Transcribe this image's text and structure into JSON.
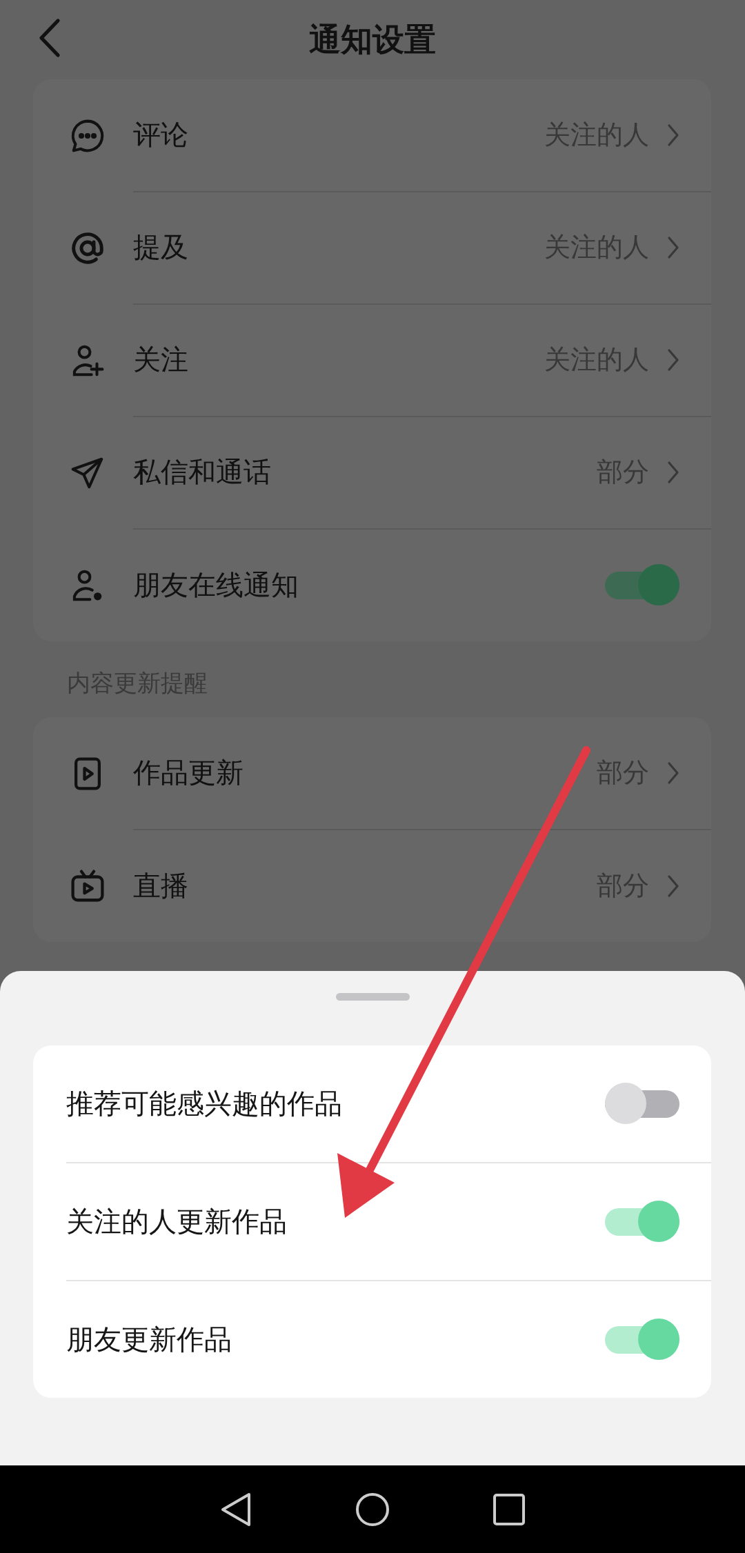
{
  "header": {
    "title": "通知设置"
  },
  "groups": [
    {
      "rows": [
        {
          "kind": "link",
          "label": "评论",
          "value": "关注的人"
        },
        {
          "kind": "link",
          "label": "提及",
          "value": "关注的人"
        },
        {
          "kind": "link",
          "label": "关注",
          "value": "关注的人"
        },
        {
          "kind": "link",
          "label": "私信和通话",
          "value": "部分"
        },
        {
          "kind": "toggle",
          "label": "朋友在线通知",
          "on": true
        }
      ]
    },
    {
      "section_title": "内容更新提醒",
      "rows": [
        {
          "kind": "link",
          "label": "作品更新",
          "value": "部分"
        },
        {
          "kind": "link",
          "label": "直播",
          "value": "部分"
        }
      ]
    }
  ],
  "sheet": {
    "rows": [
      {
        "label": "推荐可能感兴趣的作品",
        "on": false
      },
      {
        "label": "关注的人更新作品",
        "on": true
      },
      {
        "label": "朋友更新作品",
        "on": true
      }
    ]
  }
}
